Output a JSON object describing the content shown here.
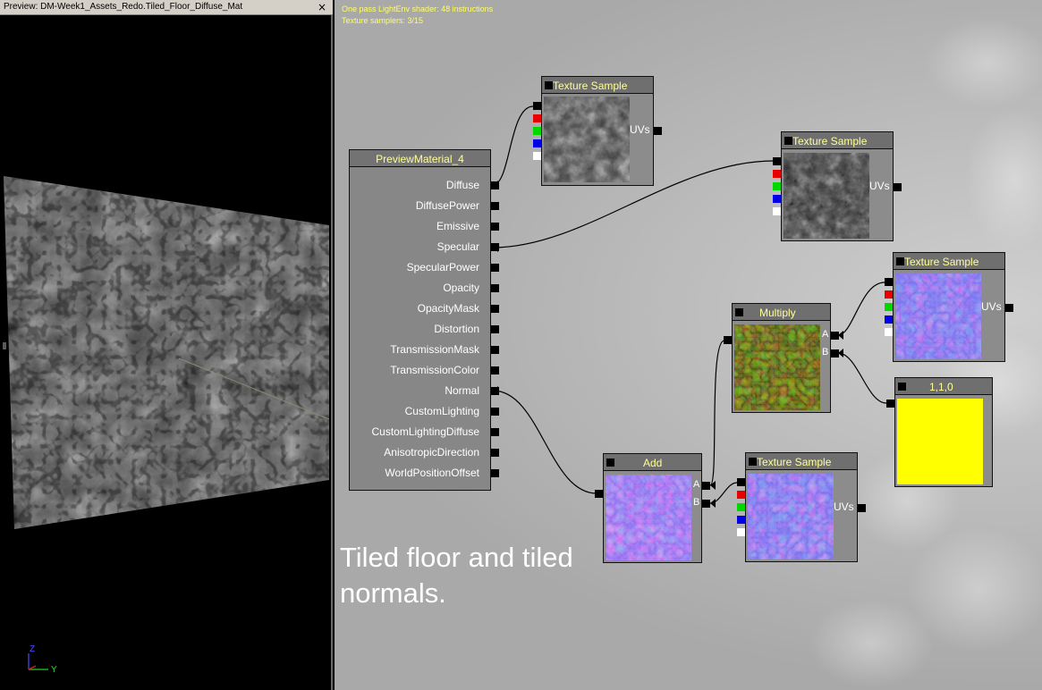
{
  "preview": {
    "title": "Preview: DM-Week1_Assets_Redo.Tiled_Floor_Diffuse_Mat",
    "close_label": "×",
    "axis": {
      "z": "Z",
      "y": "Y"
    }
  },
  "editor": {
    "stats_line1": "One pass LightEnv shader: 48 instructions",
    "stats_line2": "Texture samplers: 3/15",
    "caption": "Tiled floor and tiled normals."
  },
  "material": {
    "title": "PreviewMaterial_4",
    "inputs": [
      "Diffuse",
      "DiffusePower",
      "Emissive",
      "Specular",
      "SpecularPower",
      "Opacity",
      "OpacityMask",
      "Distortion",
      "TransmissionMask",
      "TransmissionColor",
      "Normal",
      "CustomLighting",
      "CustomLightingDiffuse",
      "AnisotropicDirection",
      "WorldPositionOffset"
    ]
  },
  "nodes": {
    "tex1": {
      "title": "Texture Sample",
      "uvs_label": "UVs"
    },
    "tex2": {
      "title": "Texture Sample",
      "uvs_label": "UVs"
    },
    "tex3": {
      "title": "Texture Sample",
      "uvs_label": "UVs"
    },
    "tex4": {
      "title": "Texture Sample",
      "uvs_label": "UVs"
    },
    "multiply": {
      "title": "Multiply",
      "a_label": "A",
      "b_label": "B"
    },
    "add": {
      "title": "Add",
      "a_label": "A",
      "b_label": "B"
    },
    "constant": {
      "title": "1,1,0",
      "color": "#ffff00"
    }
  },
  "colors": {
    "diffuse_texture": "#555555",
    "normal_texture": "#4a4ae0",
    "multiply_result": "#3a4a18",
    "wire": "#000000",
    "title_text": "#ffff99"
  }
}
